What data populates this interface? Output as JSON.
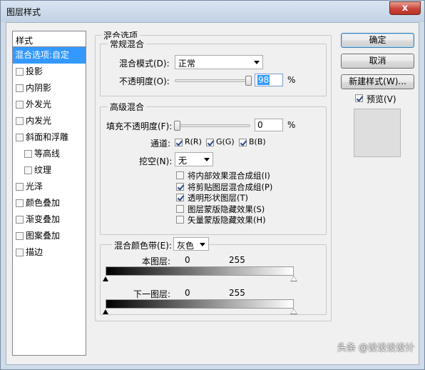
{
  "window": {
    "title": "图层样式",
    "close_glyph": "x"
  },
  "style_list": {
    "header": "样式",
    "items": [
      {
        "label": "混合选项:自定",
        "selected": true
      },
      {
        "label": "投影"
      },
      {
        "label": "内阴影"
      },
      {
        "label": "外发光"
      },
      {
        "label": "内发光"
      },
      {
        "label": "斜面和浮雕"
      },
      {
        "label": "等高线",
        "sub": true
      },
      {
        "label": "纹理",
        "sub": true
      },
      {
        "label": "光泽"
      },
      {
        "label": "颜色叠加"
      },
      {
        "label": "渐变叠加"
      },
      {
        "label": "图案叠加"
      },
      {
        "label": "描边"
      }
    ]
  },
  "blend_options": {
    "title": "混合选项",
    "general": {
      "title": "常规混合",
      "mode_label": "混合模式(D):",
      "mode_value": "正常",
      "opacity_label": "不透明度(O):",
      "opacity_value": "98",
      "opacity_unit": "%",
      "opacity_level": 0.98
    },
    "advanced": {
      "title": "高级混合",
      "fill_label": "填充不透明度(F):",
      "fill_value": "0",
      "fill_unit": "%",
      "fill_level": 0.0,
      "channels_label": "通道:",
      "channels": [
        {
          "label": "R(R)",
          "checked": true
        },
        {
          "label": "G(G)",
          "checked": true
        },
        {
          "label": "B(B)",
          "checked": true
        }
      ],
      "knockout_label": "挖空(N):",
      "knockout_value": "无",
      "options": [
        {
          "label": "将内部效果混合成组(I)",
          "checked": false
        },
        {
          "label": "将剪贴图层混合成组(P)",
          "checked": true
        },
        {
          "label": "透明形状图层(T)",
          "checked": true
        },
        {
          "label": "图层蒙版隐藏效果(S)",
          "checked": false
        },
        {
          "label": "矢量蒙版隐藏效果(H)",
          "checked": false
        }
      ]
    },
    "blend_if": {
      "label": "混合颜色带(E):",
      "value": "灰色",
      "this_layer_label": "本图层:",
      "this_layer_min": "0",
      "this_layer_max": "255",
      "underlying_label": "下一图层:",
      "underlying_min": "0",
      "underlying_max": "255"
    }
  },
  "buttons": {
    "ok": "确定",
    "cancel": "取消",
    "new_style": "新建样式(W)...",
    "preview_label": "预览(V)",
    "preview_checked": true
  },
  "watermark": "头条 @设设设设计",
  "icons": {
    "dropdown": "chevron-down-icon",
    "checkbox": "checkbox-icon",
    "slider": "slider-thumb-icon"
  }
}
